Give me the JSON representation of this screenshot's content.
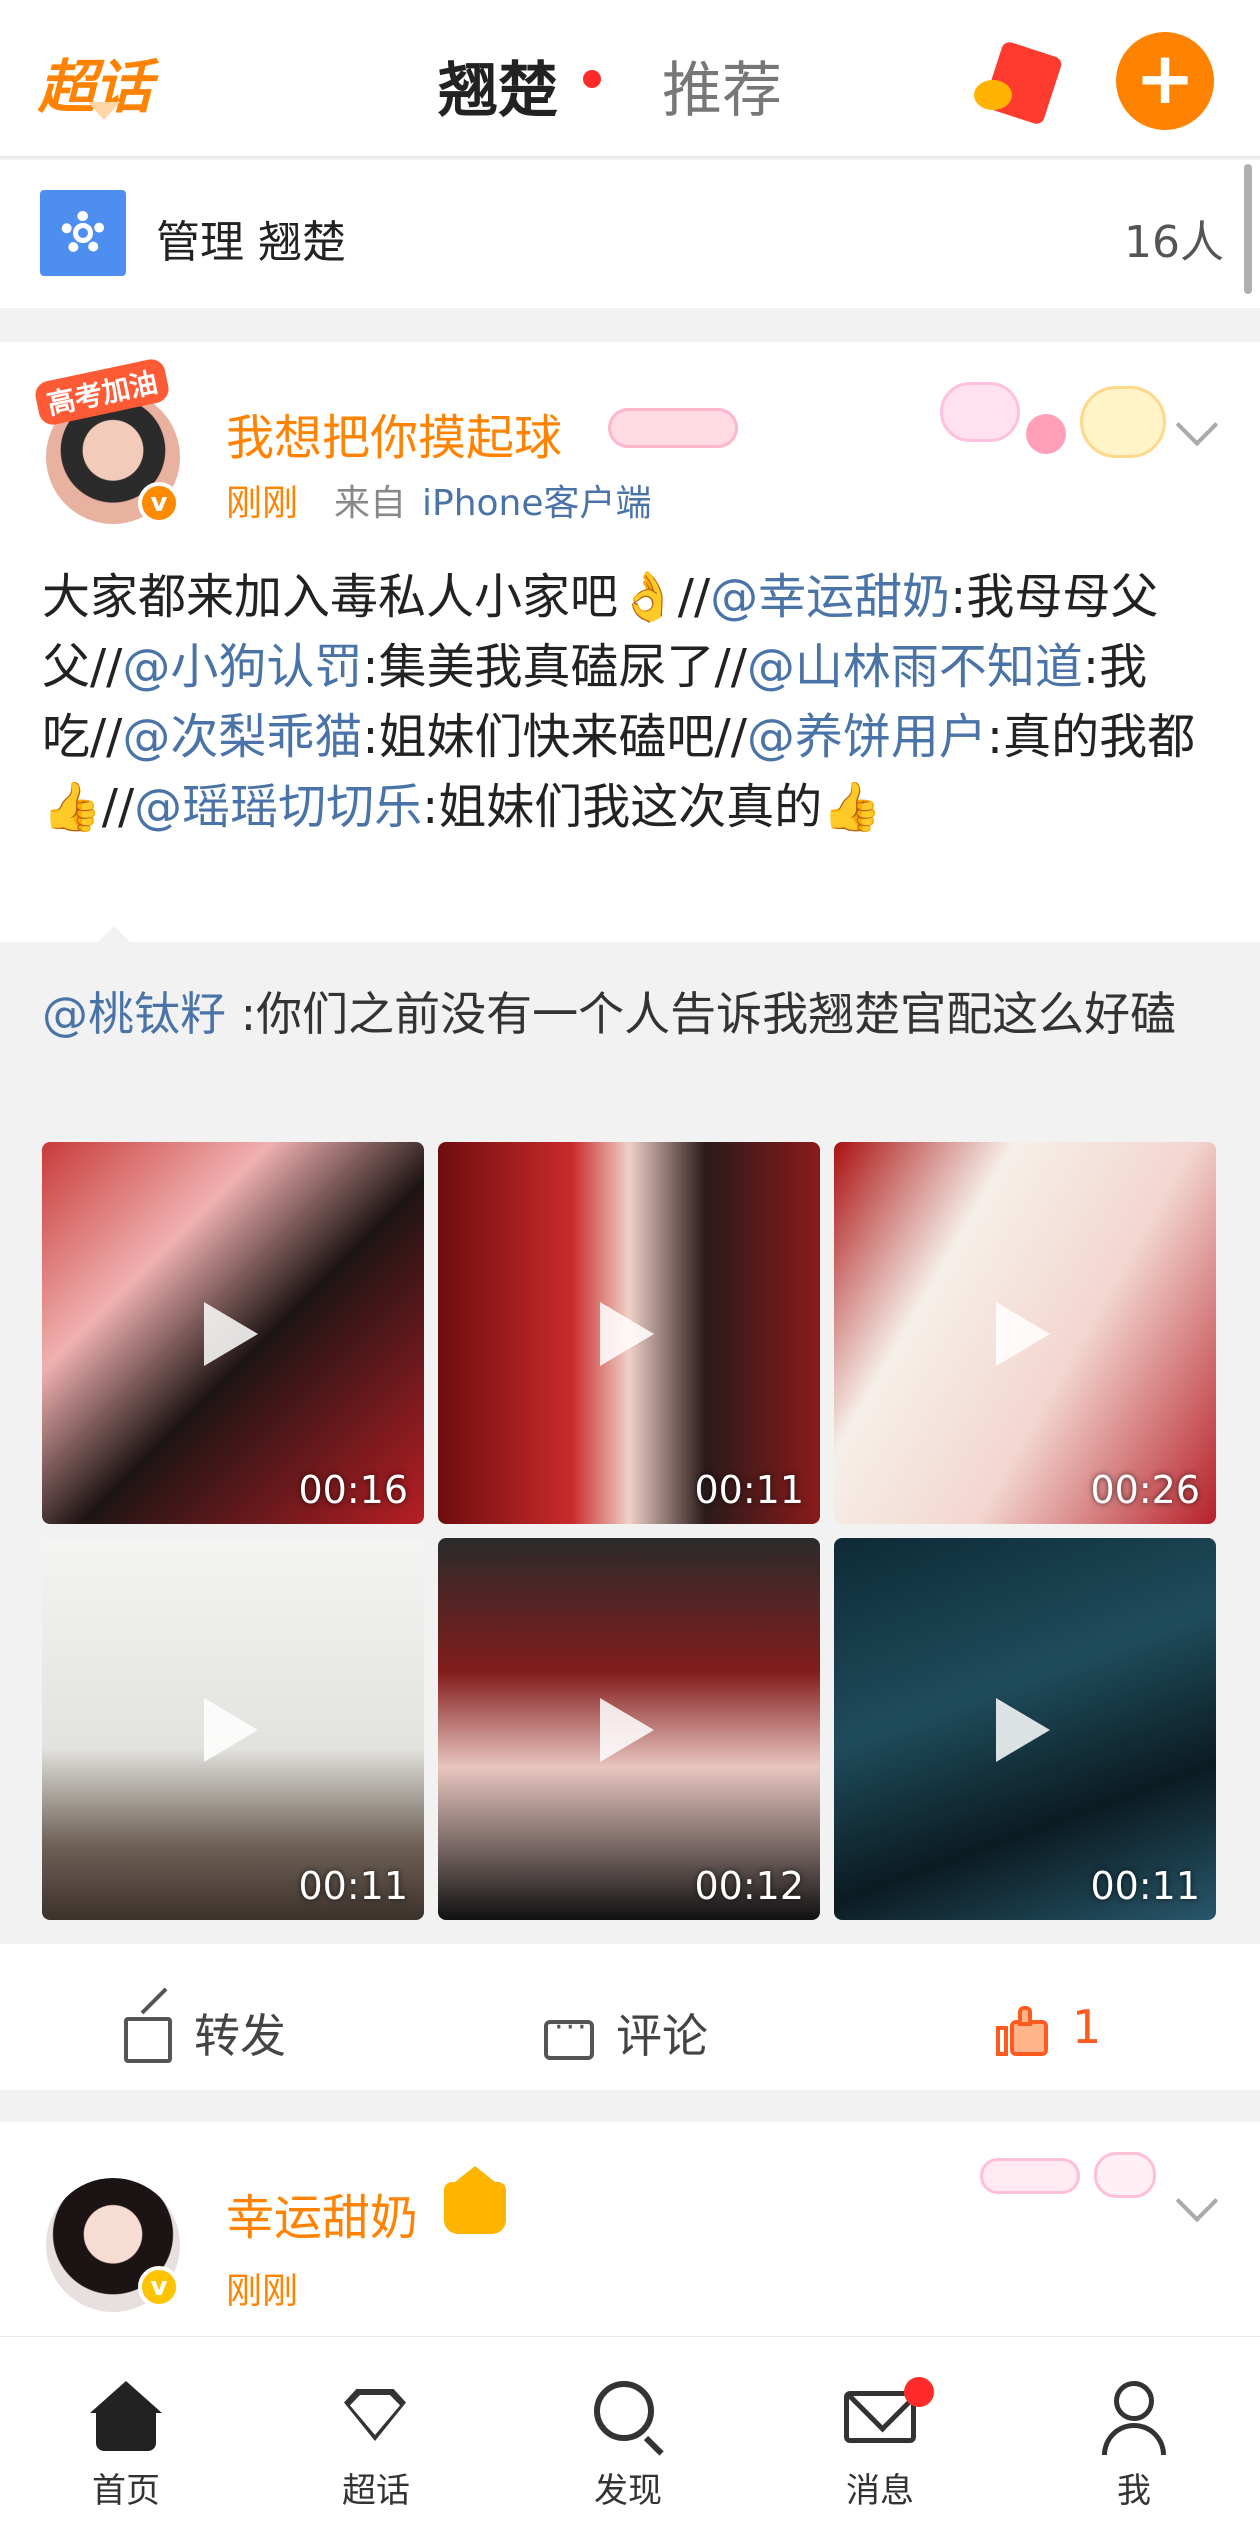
{
  "header": {
    "logo": "超话",
    "tab_active": "翘楚",
    "tab_inactive": "推荐"
  },
  "manage": {
    "label": "管理 翘楚",
    "count": "16人"
  },
  "post1": {
    "frame_tag": "高考加油",
    "username": "我想把你摸起球",
    "time": "刚刚",
    "source_prefix": "来自",
    "source": "iPhone客户端",
    "text_segments": [
      {
        "t": "大家都来加入毒私人小家吧👌//"
      },
      {
        "t": "@幸运甜奶",
        "m": true
      },
      {
        "t": ":我母母父父//"
      },
      {
        "t": "@小狗认罚",
        "m": true
      },
      {
        "t": ":集美我真磕尿了//"
      },
      {
        "t": "@山林雨不知道",
        "m": true
      },
      {
        "t": ":我吃//"
      },
      {
        "t": "@次梨乖猫",
        "m": true
      },
      {
        "t": ":姐妹们快来磕吧//"
      },
      {
        "t": "@养饼用户",
        "m": true
      },
      {
        "t": ":真的我都👍//"
      },
      {
        "t": "@瑶瑶切切乐",
        "m": true
      },
      {
        "t": ":姐妹们我这次真的👍"
      }
    ],
    "repost_mention": "@桃钛籽",
    "repost_text": " :你们之前没有一个人告诉我翘楚官配这么好磕",
    "videos": [
      {
        "duration": "00:16"
      },
      {
        "duration": "00:11"
      },
      {
        "duration": "00:26"
      },
      {
        "duration": "00:11"
      },
      {
        "duration": "00:12"
      },
      {
        "duration": "00:11"
      }
    ],
    "actions": {
      "repost": "转发",
      "comment": "评论",
      "like_count": "1"
    }
  },
  "post2": {
    "username": "幸运甜奶",
    "time": "刚刚"
  },
  "bottom_nav": [
    {
      "label": "首页",
      "icon": "home-icon"
    },
    {
      "label": "超话",
      "icon": "diamond-icon"
    },
    {
      "label": "发现",
      "icon": "search-icon"
    },
    {
      "label": "消息",
      "icon": "mail-icon"
    },
    {
      "label": "我",
      "icon": "profile-icon"
    }
  ],
  "colors": {
    "accent": "#ff8200",
    "mention": "#4a74a8",
    "like": "#ff5a1f",
    "notification_dot": "#ff2a2a"
  }
}
